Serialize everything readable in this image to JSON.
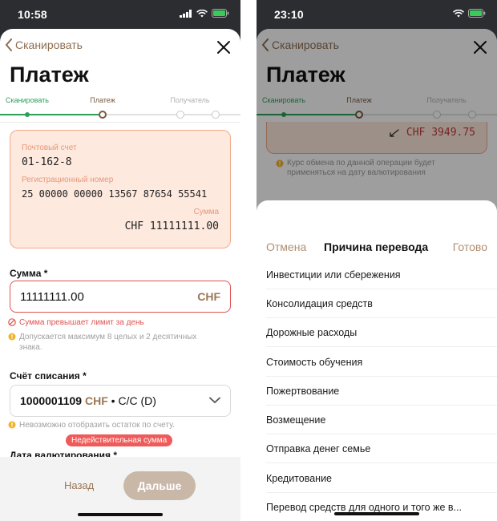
{
  "left": {
    "status_time": "10:58",
    "nav_back": "Сканировать",
    "title": "Платеж",
    "steps": [
      "Сканировать",
      "Платеж",
      "Получатель"
    ],
    "card": {
      "postal_label": "Почтовый счет",
      "postal_value": "01-162-8",
      "reg_label": "Регистрационный номер",
      "reg_value": "25 00000 00000 13567 87654 55541",
      "sum_label": "Сумма",
      "sum_value": "CHF 11111111.00"
    },
    "amount_label": "Сумма *",
    "amount_value": "11111111.00",
    "amount_currency": "CHF",
    "error_limit": "Сумма превышает лимит за день",
    "hint_decimals": "Допускается максимум 8 целых и 2 десятичных знака.",
    "debit_label": "Счёт списания *",
    "account_number": "1000001109",
    "account_currency": "CHF",
    "account_type": "• C/C (D)",
    "hint_balance": "Невозможно отобразить остаток по счету.",
    "invalid_pill": "Недействительная сумма",
    "value_date_label": "Дата валютирования *",
    "btn_back": "Назад",
    "btn_next": "Дальше"
  },
  "right": {
    "status_time": "23:10",
    "nav_back": "Сканировать",
    "title": "Платеж",
    "steps": [
      "Сканировать",
      "Платеж",
      "Получатель"
    ],
    "rate_value": "CHF 3949.75",
    "rate_hint": "Курс обмена по данной операции будет применяться на дату валютирования",
    "picker": {
      "cancel": "Отмена",
      "title": "Причина перевода",
      "done": "Готово",
      "items": [
        "Инвестиции или сбережения",
        "Консолидация средств",
        "Дорожные расходы",
        "Стоимость обучения",
        "Пожертвование",
        "Возмещение",
        "Отправка денег семье",
        "Кредитование",
        "Перевод средств для одного и того же в..."
      ]
    }
  },
  "colors": {
    "accent_brown": "#9a7655",
    "step_done_green": "#2e9e5b",
    "error_red": "#e05252",
    "card_bg": "#fde9de",
    "card_border": "#f2a98a"
  },
  "icons": [
    "chevron-left-icon",
    "close-icon",
    "wifi-icon",
    "signal-icon",
    "battery-icon",
    "error-icon",
    "info-icon",
    "chevron-down-icon",
    "exchange-icon"
  ]
}
